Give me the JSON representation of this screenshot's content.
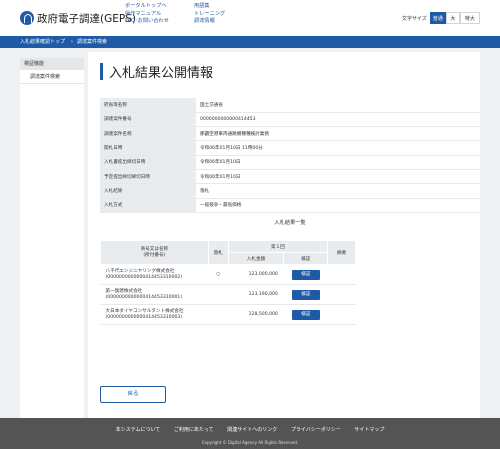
{
  "header": {
    "logo_text": "政府電子調達(GEPS)",
    "links_col1": [
      "ポータルトップへ",
      "操作マニュアル",
      "FAQ･お問い合わせ"
    ],
    "links_col2": [
      "用語集",
      "トレーニング",
      "調達情報"
    ],
    "font_size_label": "文字サイズ",
    "font_sizes": [
      "普通",
      "大",
      "特大"
    ],
    "active_font_size": "普通"
  },
  "breadcrumb": [
    "入札結果確認トップ",
    "調達案件検索"
  ],
  "sidebar": {
    "heading": "検証機能",
    "items": [
      "調達案件検索"
    ]
  },
  "page_title": "入札結果公開情報",
  "info_rows": [
    {
      "label": "府省等名称",
      "value": "国土交通省"
    },
    {
      "label": "調達案件番号",
      "value": "0000000000000414453"
    },
    {
      "label": "調達案件名称",
      "value": "那覇空港車両通路機種種検討業務"
    },
    {
      "label": "開札日時",
      "value": "令和06年01月10日 11時00分"
    },
    {
      "label": "入札書提出締切日時",
      "value": "令和06年01月10日"
    },
    {
      "label": "予定提出締切締切日時",
      "value": "令和06年01月10日"
    },
    {
      "label": "入札結果",
      "value": "落札"
    },
    {
      "label": "入札方式",
      "value": "一般競争・最低価格"
    }
  ],
  "results_title": "入札結果一覧",
  "results_headers": {
    "bidder": "商号又は名称\n(所付番号)",
    "awarded": "落札",
    "round": "第１回",
    "amount": "入札金額",
    "verify": "検証",
    "remarks": "摘要"
  },
  "results": [
    {
      "name": "八千代エンジニヤリング株式会社",
      "id": "(0000000000000414453310002)",
      "awarded": "○",
      "amount": "123,000,000",
      "verify": "検証",
      "remarks": ""
    },
    {
      "name": "第一復建株式会社",
      "id": "(0000000000000414453310001)",
      "awarded": "",
      "amount": "123,190,000",
      "verify": "検証",
      "remarks": ""
    },
    {
      "name": "大日本ダイヤコンサルタント株式会社",
      "id": "(0000000000000414453310003)",
      "awarded": "",
      "amount": "128,500,000",
      "verify": "検証",
      "remarks": ""
    }
  ],
  "back_button": "戻る",
  "footer": {
    "links": [
      "本システムについて",
      "ご利用にあたって",
      "関連サイトへのリンク",
      "プライバシーポリシー",
      "サイトマップ"
    ],
    "copyright": "Copyright © Digital Agency All Rights Reserved."
  },
  "colors": {
    "accent": "#1f5aa6",
    "footer": "#545454",
    "background": "#eef0f2"
  }
}
